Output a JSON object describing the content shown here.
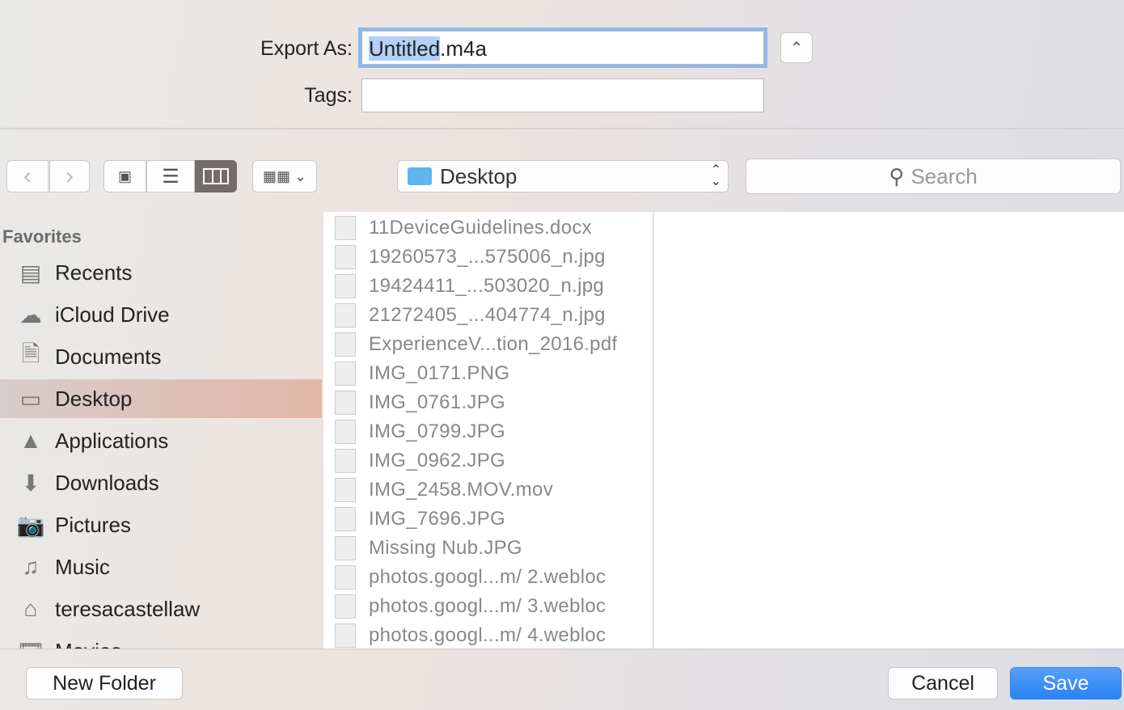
{
  "export": {
    "label": "Export As:",
    "filename_selected": "Untitled",
    "filename_ext": ".m4a"
  },
  "tags": {
    "label": "Tags:",
    "value": ""
  },
  "toolbar": {
    "location": "Desktop",
    "search_placeholder": "Search"
  },
  "sidebar": {
    "header": "Favorites",
    "items": [
      {
        "label": "Recents",
        "icon": "recents-icon"
      },
      {
        "label": "iCloud Drive",
        "icon": "cloud-icon"
      },
      {
        "label": "Documents",
        "icon": "documents-icon"
      },
      {
        "label": "Desktop",
        "icon": "desktop-icon",
        "active": true
      },
      {
        "label": "Applications",
        "icon": "applications-icon"
      },
      {
        "label": "Downloads",
        "icon": "downloads-icon"
      },
      {
        "label": "Pictures",
        "icon": "camera-icon"
      },
      {
        "label": "Music",
        "icon": "music-icon"
      },
      {
        "label": "teresacastellaw",
        "icon": "home-icon"
      },
      {
        "label": "Movies",
        "icon": "movies-icon"
      }
    ]
  },
  "files": [
    "11DeviceGuidelines.docx",
    "19260573_...575006_n.jpg",
    "19424411_...503020_n.jpg",
    "21272405_...404774_n.jpg",
    "ExperienceV...tion_2016.pdf",
    "IMG_0171.PNG",
    "IMG_0761.JPG",
    "IMG_0799.JPG",
    "IMG_0962.JPG",
    "IMG_2458.MOV.mov",
    "IMG_7696.JPG",
    "Missing Nub.JPG",
    "photos.googl...m/ 2.webloc",
    "photos.googl...m/ 3.webloc",
    "photos.googl...m/ 4.webloc"
  ],
  "buttons": {
    "new_folder": "New Folder",
    "cancel": "Cancel",
    "save": "Save"
  },
  "colors": {
    "accent": "#3b8cf5",
    "selection": "#b3d0f7"
  }
}
